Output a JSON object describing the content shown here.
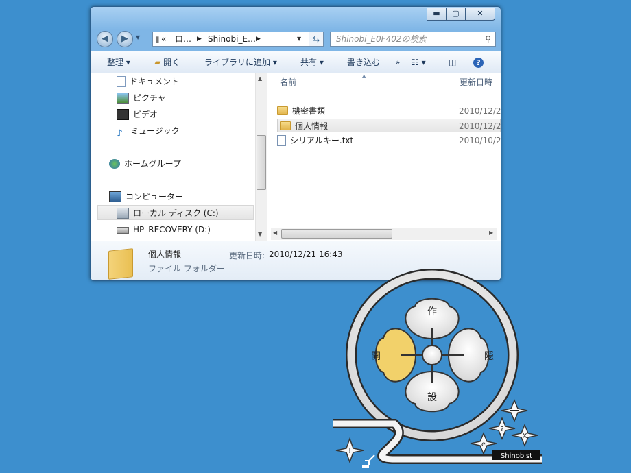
{
  "window": {
    "caption_buttons": {
      "minimize": "▬",
      "maximize": "▢",
      "close": "✕"
    }
  },
  "address_bar": {
    "prefix": "«",
    "segment1": "ロ…",
    "segment2": "Shinobi_E…",
    "search_placeholder": "Shinobi_E0F402の検索"
  },
  "toolbar": {
    "organize": "整理",
    "open": "開く",
    "library": "ライブラリに追加",
    "share": "共有",
    "burn": "書き込む",
    "more": "»"
  },
  "nav_pane": {
    "items": [
      {
        "label": "ドキュメント",
        "icon": "document-icon"
      },
      {
        "label": "ピクチャ",
        "icon": "pictures-icon"
      },
      {
        "label": "ビデオ",
        "icon": "video-icon"
      },
      {
        "label": "ミュージック",
        "icon": "music-icon"
      },
      {
        "label": "ホームグループ",
        "icon": "homegroup-icon"
      },
      {
        "label": "コンピューター",
        "icon": "computer-icon"
      },
      {
        "label": "ローカル ディスク (C:)",
        "icon": "local-disk-icon"
      },
      {
        "label": "HP_RECOVERY (D:)",
        "icon": "drive-icon"
      }
    ]
  },
  "file_list": {
    "columns": {
      "name": "名前",
      "date": "更新日時"
    },
    "rows": [
      {
        "name": "機密書類",
        "date": "2010/12/2",
        "type": "folder"
      },
      {
        "name": "個人情報",
        "date": "2010/12/2",
        "type": "folder"
      },
      {
        "name": "シリアルキー.txt",
        "date": "2010/10/2",
        "type": "text"
      }
    ]
  },
  "details_pane": {
    "name": "個人情報",
    "type": "ファイル フォルダー",
    "modified_label": "更新日時:",
    "modified_value": "2010/12/21 16:43"
  },
  "emblem": {
    "petal_top": "作",
    "petal_left": "開",
    "petal_right": "隠",
    "petal_bottom": "設",
    "brand": "Shinobist",
    "icon_letters": [
      "!",
      "e",
      "?",
      "X"
    ]
  },
  "colors": {
    "desktop": "#3d8fce",
    "accent_petal": "#f2d16a"
  }
}
